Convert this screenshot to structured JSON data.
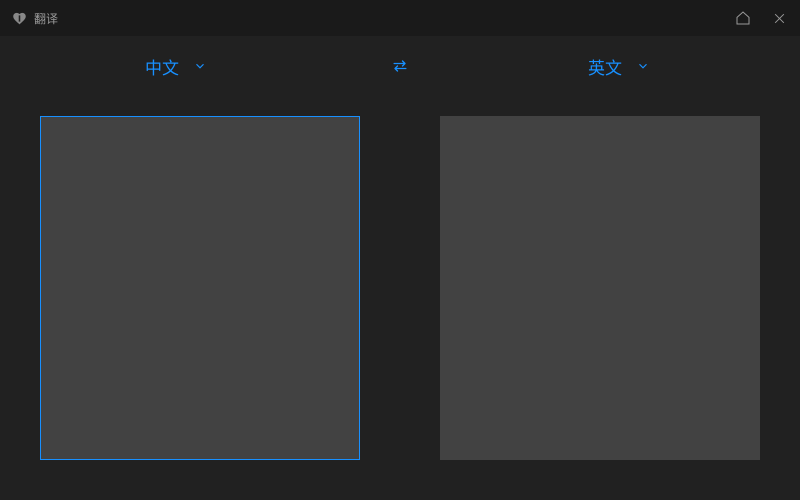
{
  "titlebar": {
    "title": "翻译"
  },
  "languages": {
    "source": "中文",
    "target": "英文"
  },
  "panes": {
    "source_value": "",
    "target_value": ""
  }
}
